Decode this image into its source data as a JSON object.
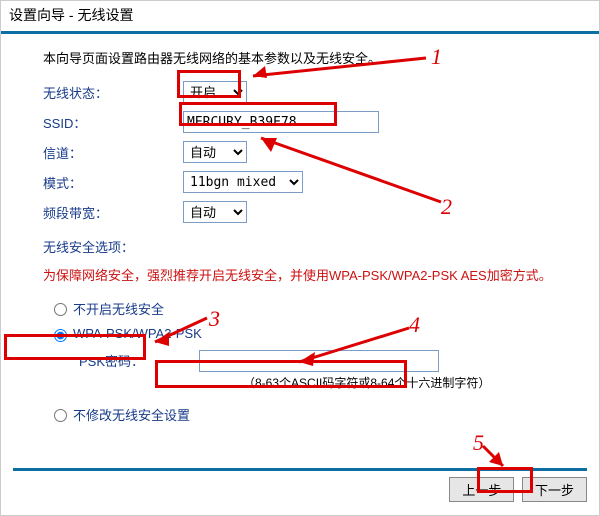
{
  "window_title": "设置向导 - 无线设置",
  "intro": "本向导页面设置路由器无线网络的基本参数以及无线安全。",
  "fields": {
    "wireless_state": {
      "label": "无线状态：",
      "value": "开启"
    },
    "ssid": {
      "label": "SSID：",
      "value": "MERCURY_B39E78"
    },
    "channel": {
      "label": "信道：",
      "value": "自动"
    },
    "mode": {
      "label": "模式：",
      "value": "11bgn mixed"
    },
    "bandwidth": {
      "label": "频段带宽：",
      "value": "自动"
    }
  },
  "security": {
    "section_label": "无线安全选项：",
    "warning": "为保障网络安全，强烈推荐开启无线安全，并使用WPA-PSK/WPA2-PSK AES加密方式。",
    "opt_none": {
      "label": "不开启无线安全"
    },
    "opt_wpa": {
      "label": "WPA-PSK/WPA2-PSK"
    },
    "opt_keep": {
      "label": "不修改无线安全设置"
    },
    "psk_label": "PSK密码：",
    "psk_value": "",
    "psk_hint": "（8-63个ASCII码字符或8-64个十六进制字符）"
  },
  "buttons": {
    "prev": "上一步",
    "next": "下一步"
  },
  "annotations": {
    "n1": "1",
    "n2": "2",
    "n3": "3",
    "n4": "4",
    "n5": "5"
  }
}
